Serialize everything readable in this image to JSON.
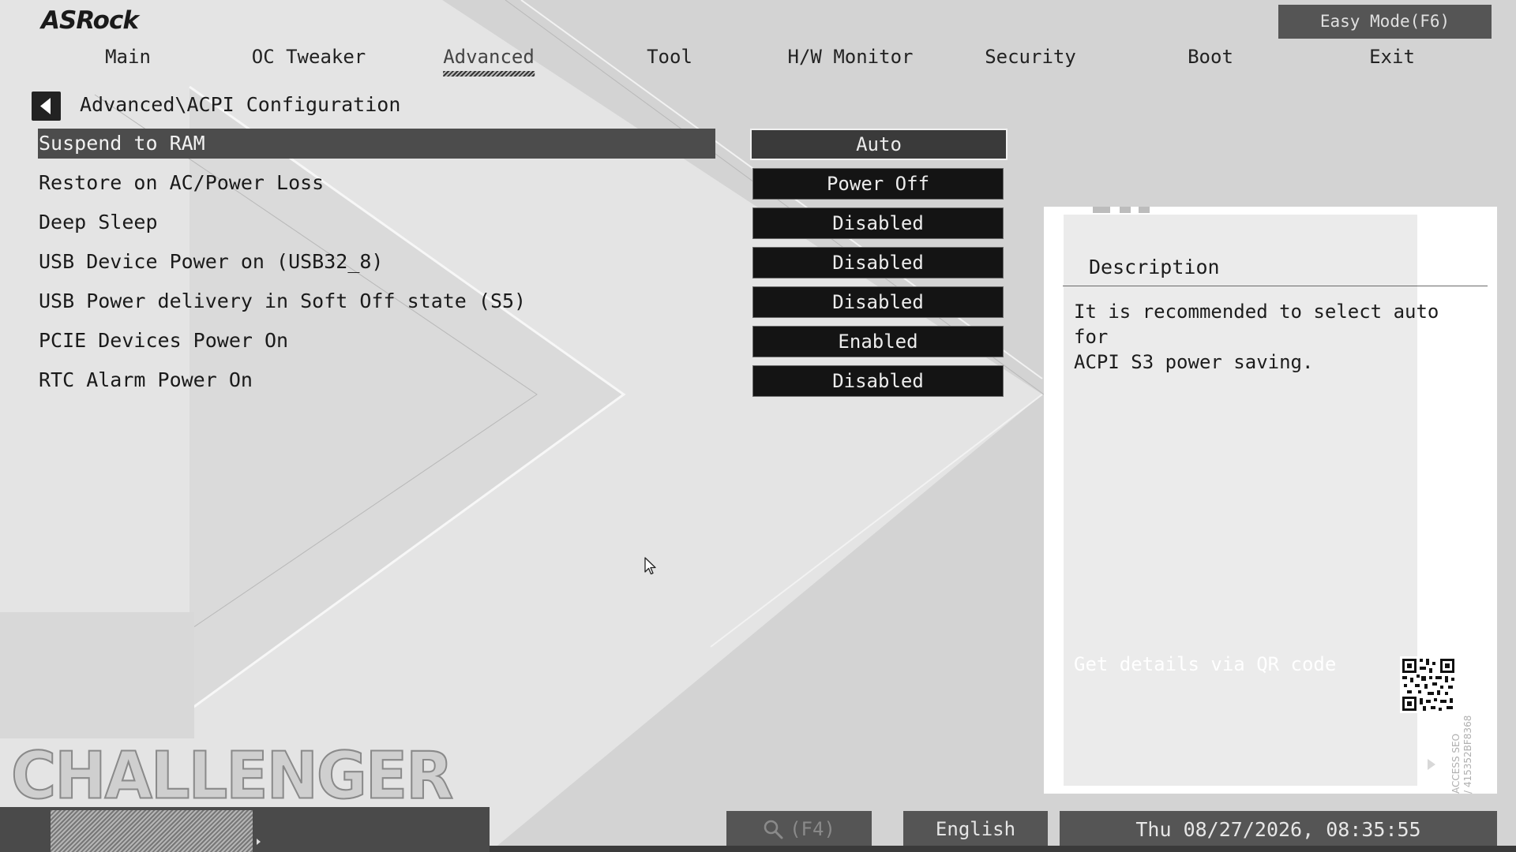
{
  "brand": {
    "logo_text": "ASRock",
    "edition_watermark": "CHALLENGER"
  },
  "header": {
    "easy_mode_label": "Easy Mode(F6)"
  },
  "nav": {
    "tabs": [
      {
        "label": "Main",
        "active": false
      },
      {
        "label": "OC Tweaker",
        "active": false
      },
      {
        "label": "Advanced",
        "active": true
      },
      {
        "label": "Tool",
        "active": false
      },
      {
        "label": "H/W Monitor",
        "active": false
      },
      {
        "label": "Security",
        "active": false
      },
      {
        "label": "Boot",
        "active": false
      },
      {
        "label": "Exit",
        "active": false
      }
    ]
  },
  "breadcrumb": {
    "path": "Advanced\\ACPI Configuration",
    "back_icon": "back-arrow-icon"
  },
  "settings": {
    "items": [
      {
        "label": "Suspend to RAM",
        "value": "Auto",
        "selected": true
      },
      {
        "label": "Restore on AC/Power Loss",
        "value": "Power Off",
        "selected": false
      },
      {
        "label": "Deep Sleep",
        "value": "Disabled",
        "selected": false
      },
      {
        "label": "USB Device Power on (USB32_8)",
        "value": "Disabled",
        "selected": false
      },
      {
        "label": "USB Power delivery in Soft Off state (S5)",
        "value": "Disabled",
        "selected": false
      },
      {
        "label": "PCIE Devices Power On",
        "value": "Enabled",
        "selected": false
      },
      {
        "label": "RTC Alarm Power On",
        "value": "Disabled",
        "selected": false
      }
    ]
  },
  "description": {
    "title": "Description",
    "text_lines": [
      "It is recommended to select auto for",
      "ACPI S3 power saving."
    ],
    "qr_label": "Get details via QR code",
    "qr_side_text_lines": [
      "ACCESS SEO",
      "/ 415352BF8368"
    ]
  },
  "footer": {
    "search_label": "(F4)",
    "search_icon": "search-icon",
    "language": "English",
    "datetime": "Thu 08/27/2026, 08:35:55"
  },
  "colors": {
    "background": "#e4e4e4",
    "bar": "#555555",
    "selected_row": "#4c4c4c",
    "value_button": "#141414",
    "panel": "#ffffff"
  }
}
